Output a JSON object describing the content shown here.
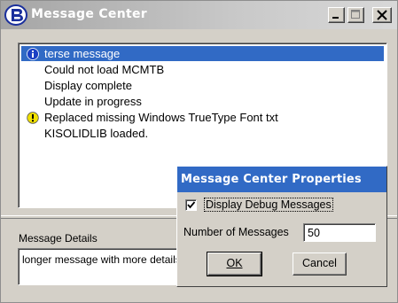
{
  "window": {
    "title": "Message Center"
  },
  "messages": [
    {
      "text": "terse message",
      "icon": "info-icon",
      "selected": true
    },
    {
      "text": "Could not load MCMTB",
      "icon": null
    },
    {
      "text": "Display complete",
      "icon": null
    },
    {
      "text": "Update in progress",
      "icon": null
    },
    {
      "text": "Replaced missing Windows TrueType Font txt",
      "icon": "warning-icon"
    },
    {
      "text": "KISOLIDLIB loaded.",
      "icon": null
    }
  ],
  "details": {
    "label": "Message Details",
    "text": "longer message with more details"
  },
  "dialog": {
    "title": "Message Center Properties",
    "debug_label": "Display Debug Messages",
    "debug_checked": true,
    "num_label": "Number of Messages",
    "num_value": "50",
    "ok_label": "OK",
    "cancel_label": "Cancel"
  },
  "colors": {
    "selection": "#316ac5",
    "dialog_title": "#316ac5",
    "info_icon": "#1a3fc4",
    "warning_icon": "#f0e000"
  }
}
